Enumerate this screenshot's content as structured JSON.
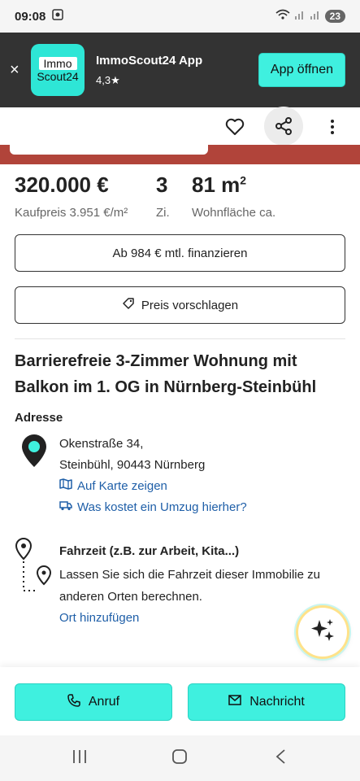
{
  "status": {
    "time": "09:08",
    "notification_count": "23"
  },
  "banner": {
    "close": "×",
    "logo_line1": "Immo",
    "logo_line2": "Scout24",
    "app_name": "ImmoScout24 App",
    "rating": "4,3★",
    "open_button": "App öffnen"
  },
  "listing": {
    "price": "320.000 €",
    "price_per_sqm": "Kaufpreis 3.951 €/m²",
    "rooms": "3",
    "rooms_unit": "Zi.",
    "area_value": "81 m",
    "area_sup": "2",
    "area_label": "Wohnfläche ca.",
    "financing_button": "Ab 984 € mtl. finanzieren",
    "suggest_price_button": "Preis vorschlagen",
    "title": "Barrierefreie 3-Zimmer Wohnung mit Balkon im 1. OG in Nürnberg-Steinbühl"
  },
  "address": {
    "heading": "Adresse",
    "street": "Okenstraße 34,",
    "city": "Steinbühl, 90443 Nürnberg",
    "map_link": "Auf Karte zeigen",
    "moving_link": "Was kostet ein Umzug hierher?"
  },
  "travel": {
    "title": "Fahrzeit (z.B. zur Arbeit, Kita...)",
    "description": "Lassen Sie sich die Fahrzeit dieser Immobilie zu anderen Orten berechnen.",
    "add_link": "Ort hinzufügen"
  },
  "actions": {
    "call": "Anruf",
    "message": "Nachricht"
  },
  "colors": {
    "accent": "#3ff0df",
    "banner_bg": "#333333",
    "link": "#1f5fa8"
  }
}
